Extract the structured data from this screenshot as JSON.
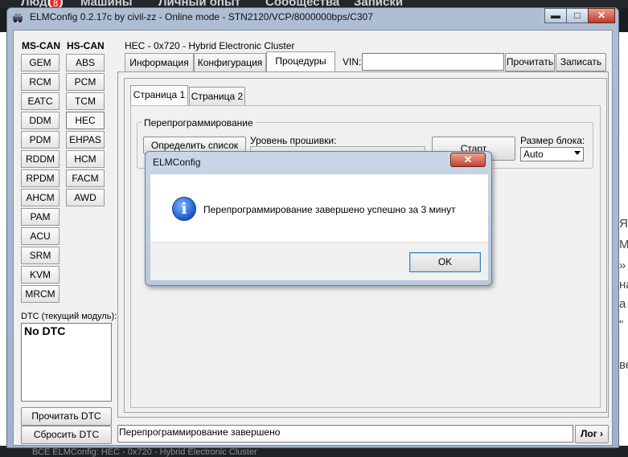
{
  "background": {
    "nav_items": [
      "Люди",
      "Машины",
      "Личный опыт",
      "Сообщества",
      "Записки"
    ],
    "badge": "8",
    "right_fragments": [
      "Я",
      "М",
      "»",
      "на",
      "а",
      "\"",
      "ве"
    ],
    "bottom_text": "ВСЕ ELMConfig: HEC - 0x720 - Hybrid Electronic Cluster"
  },
  "window": {
    "title": "ELMConfig 0.2.17c by civil-zz - Online mode - STN2120/VCP/8000000bps/C307",
    "caption_buttons": {
      "minimize": "▬",
      "maximize": "□",
      "close": "✕"
    }
  },
  "left_panel": {
    "ms_can_header": "MS-CAN",
    "hs_can_header": "HS-CAN",
    "ms_can_modules": [
      "GEM",
      "RCM",
      "EATC",
      "DDM",
      "PDM",
      "RDDM",
      "RPDM",
      "AHCM",
      "PAM",
      "ACU",
      "SRM",
      "KVM",
      "MRCM"
    ],
    "hs_can_modules": [
      "ABS",
      "PCM",
      "TCM",
      "HEC",
      "EHPAS",
      "HCM",
      "FACM",
      "AWD"
    ],
    "selected_module": "HEC",
    "dtc_label": "DTC (текущий модуль):",
    "dtc_text": "No DTC",
    "read_dtc_button": "Прочитать DTC",
    "clear_dtc_button": "Сбросить DTC"
  },
  "main": {
    "module_title": "HEC - 0x720 - Hybrid Electronic Cluster",
    "tabs": [
      "Информация",
      "Конфигурация",
      "Процедуры"
    ],
    "active_tab": "Процедуры",
    "vin_label": "VIN:",
    "vin_value": "",
    "read_button": "Прочитать",
    "write_button": "Записать",
    "page_tabs": [
      "Страница 1",
      "Страница 2"
    ],
    "active_page": "Страница 1",
    "reprogram_group": "Перепрограммирование",
    "detect_list_button": "Определить список",
    "firmware_level_label": "Уровень прошивки:",
    "start_button": "Старт",
    "block_size_label": "Размер блока:",
    "block_size_value": "Auto",
    "status_text": "Перепрограммирование завершено",
    "log_button": "Лог ›"
  },
  "dialog": {
    "title": "ELMConfig",
    "close": "✕",
    "icon": "info-icon",
    "message": "Перепрограммирование завершено успешно за 3 минут",
    "ok_button": "OK"
  }
}
